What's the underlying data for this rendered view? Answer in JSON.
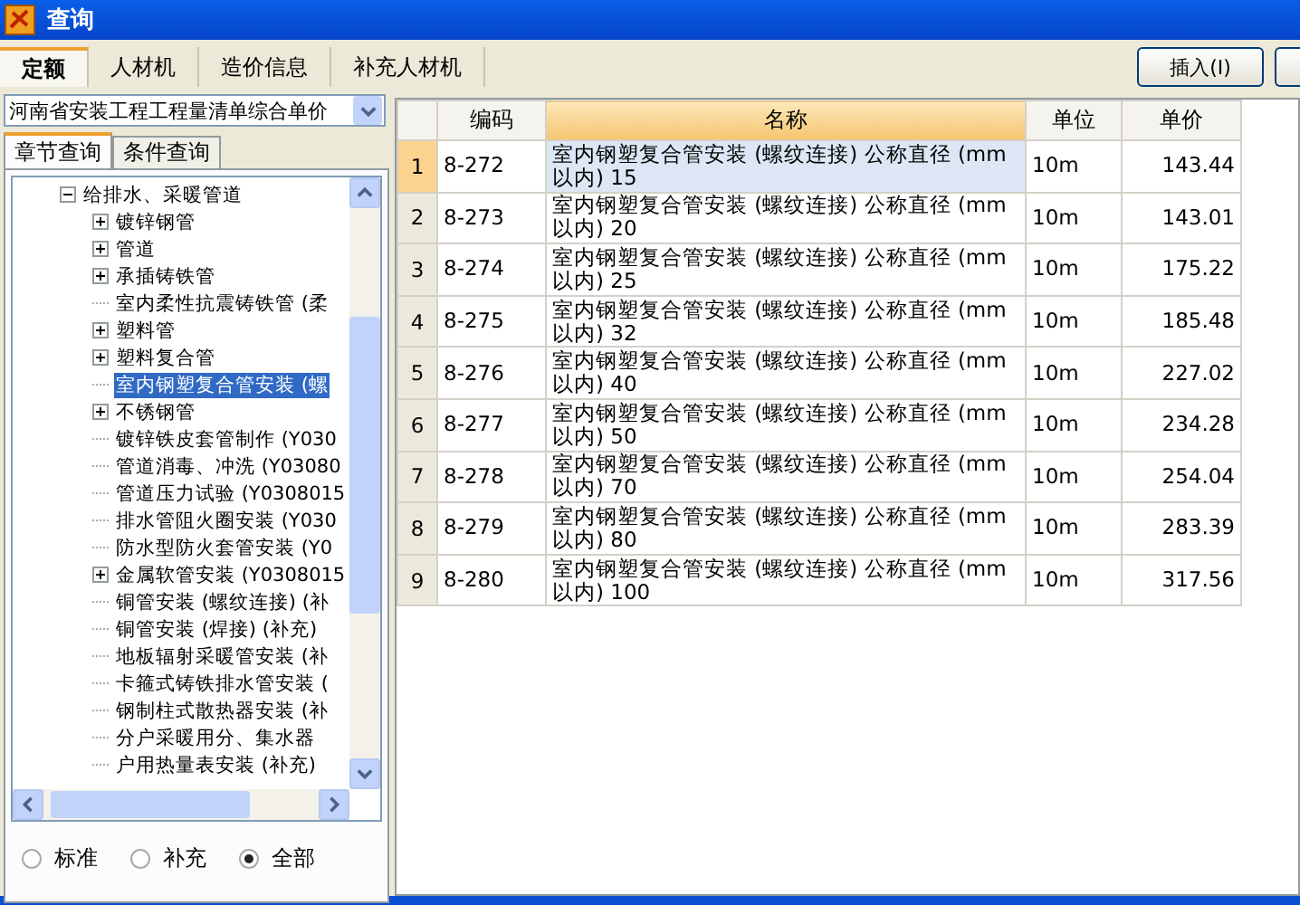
{
  "window": {
    "title": "查询"
  },
  "tabs": [
    {
      "label": "定额",
      "selected": true
    },
    {
      "label": "人材机",
      "selected": false
    },
    {
      "label": "造价信息",
      "selected": false
    },
    {
      "label": "补充人材机",
      "selected": false
    }
  ],
  "toolbar": {
    "buttons": [
      "插入(I)"
    ]
  },
  "library_select": {
    "value": "河南省安装工程工程量清单综合单价"
  },
  "sub_tabs": [
    {
      "label": "章节查询",
      "selected": true
    },
    {
      "label": "条件查询",
      "selected": false
    }
  ],
  "tree": [
    {
      "label": "给排水、采暖管道",
      "expanded": true,
      "selected": false,
      "children": [
        {
          "label": "镀锌钢管",
          "expanded": false,
          "selected": false
        },
        {
          "label": "管道",
          "expanded": false,
          "selected": false
        },
        {
          "label": "承插铸铁管",
          "expanded": false,
          "selected": false
        },
        {
          "label": "室内柔性抗震铸铁管 (柔",
          "selected": false
        },
        {
          "label": "塑料管",
          "expanded": false,
          "selected": false
        },
        {
          "label": "塑料复合管",
          "expanded": false,
          "selected": false
        },
        {
          "label": "室内钢塑复合管安装 (螺",
          "selected": true
        },
        {
          "label": "不锈钢管",
          "expanded": false,
          "selected": false
        },
        {
          "label": "镀锌铁皮套管制作 (Y030",
          "selected": false
        },
        {
          "label": "管道消毒、冲洗 (Y03080",
          "selected": false
        },
        {
          "label": "管道压力试验 (Y0308015",
          "selected": false
        },
        {
          "label": "排水管阻火圈安装 (Y030",
          "selected": false
        },
        {
          "label": "防水型防火套管安装 (Y0",
          "selected": false
        },
        {
          "label": "金属软管安装 (Y0308015",
          "expanded": false,
          "selected": false
        },
        {
          "label": "铜管安装 (螺纹连接) (补",
          "selected": false
        },
        {
          "label": "铜管安装 (焊接) (补充)",
          "selected": false
        },
        {
          "label": "地板辐射采暖管安装 (补",
          "selected": false
        },
        {
          "label": "卡箍式铸铁排水管安装 (",
          "selected": false
        },
        {
          "label": "钢制柱式散热器安装 (补",
          "selected": false
        },
        {
          "label": "分户采暖用分、集水器",
          "selected": false
        },
        {
          "label": "户用热量表安装 (补充)",
          "selected": false
        }
      ]
    }
  ],
  "filter": [
    {
      "label": "标准",
      "selected": false
    },
    {
      "label": "补充",
      "selected": false
    },
    {
      "label": "全部",
      "selected": true
    }
  ],
  "table": {
    "columns": [
      {
        "label": "编码",
        "selected": false
      },
      {
        "label": "名称",
        "selected": true
      },
      {
        "label": "单位",
        "selected": false
      },
      {
        "label": "单价",
        "selected": false
      }
    ],
    "rows": [
      {
        "index": "1",
        "code": "8-272",
        "name": "室内钢塑复合管安装 (螺纹连接) 公称直径 (mm以内) 15",
        "unit": "10m",
        "price": "143.44",
        "selected": true
      },
      {
        "index": "2",
        "code": "8-273",
        "name": "室内钢塑复合管安装 (螺纹连接) 公称直径 (mm以内) 20",
        "unit": "10m",
        "price": "143.01",
        "selected": false
      },
      {
        "index": "3",
        "code": "8-274",
        "name": "室内钢塑复合管安装 (螺纹连接) 公称直径 (mm以内) 25",
        "unit": "10m",
        "price": "175.22",
        "selected": false
      },
      {
        "index": "4",
        "code": "8-275",
        "name": "室内钢塑复合管安装 (螺纹连接) 公称直径 (mm以内) 32",
        "unit": "10m",
        "price": "185.48",
        "selected": false
      },
      {
        "index": "5",
        "code": "8-276",
        "name": "室内钢塑复合管安装 (螺纹连接) 公称直径 (mm以内) 40",
        "unit": "10m",
        "price": "227.02",
        "selected": false
      },
      {
        "index": "6",
        "code": "8-277",
        "name": "室内钢塑复合管安装 (螺纹连接) 公称直径 (mm以内) 50",
        "unit": "10m",
        "price": "234.28",
        "selected": false
      },
      {
        "index": "7",
        "code": "8-278",
        "name": "室内钢塑复合管安装 (螺纹连接) 公称直径 (mm以内) 70",
        "unit": "10m",
        "price": "254.04",
        "selected": false
      },
      {
        "index": "8",
        "code": "8-279",
        "name": "室内钢塑复合管安装 (螺纹连接) 公称直径 (mm以内) 80",
        "unit": "10m",
        "price": "283.39",
        "selected": false
      },
      {
        "index": "9",
        "code": "8-280",
        "name": "室内钢塑复合管安装 (螺纹连接) 公称直径 (mm以内) 100",
        "unit": "10m",
        "price": "317.56",
        "selected": false
      }
    ]
  }
}
